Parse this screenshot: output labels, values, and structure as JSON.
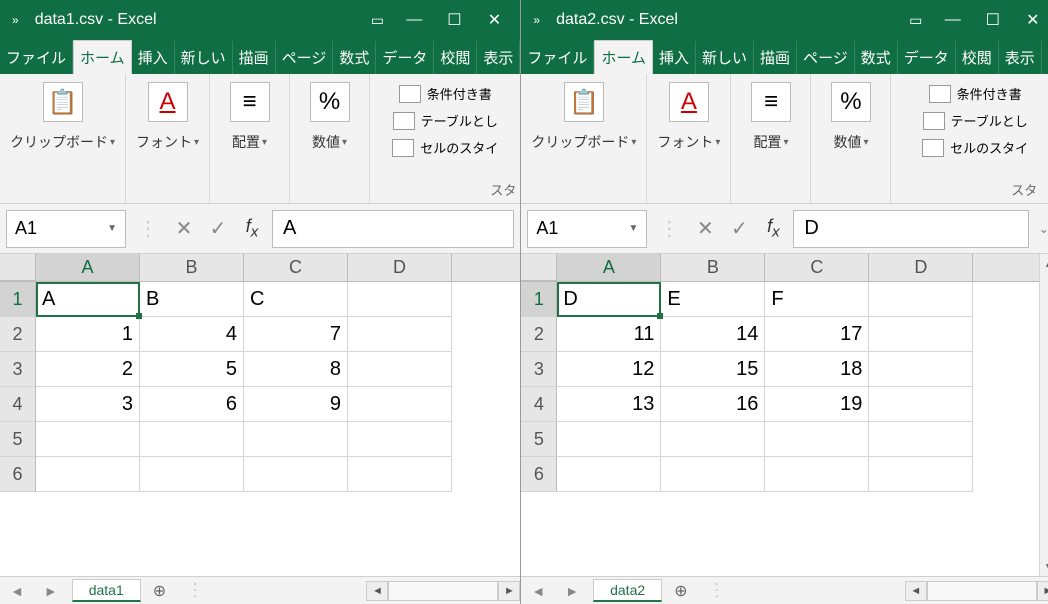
{
  "tabs": {
    "file": "ファイル",
    "home": "ホーム",
    "insert": "挿入",
    "new": "新しい",
    "draw": "描画",
    "page": "ページ",
    "formula": "数式",
    "data": "データ",
    "review": "校閲",
    "view": "表示"
  },
  "ribbon_groups": {
    "clipboard": "クリップボード",
    "font": "フォント",
    "align": "配置",
    "number": "数値",
    "styles_label": "スタ",
    "cond_fmt": "条件付き書",
    "as_table": "テーブルとし",
    "cell_styles": "セルのスタイ"
  },
  "icons": {
    "font": "A",
    "percent": "%"
  },
  "columns": [
    "A",
    "B",
    "C",
    "D"
  ],
  "windows": [
    {
      "title": "data1.csv  -  Excel",
      "namebox": "A1",
      "formula_value": "A",
      "sheet_name": "data1",
      "active": {
        "row": 0,
        "col": 0
      },
      "has_vscroll": false,
      "has_fx_expand": false,
      "rows": [
        {
          "hdr": "1",
          "cells": [
            {
              "v": "A"
            },
            {
              "v": "B"
            },
            {
              "v": "C"
            },
            {
              "v": ""
            }
          ]
        },
        {
          "hdr": "2",
          "cells": [
            {
              "v": "1",
              "n": true
            },
            {
              "v": "4",
              "n": true
            },
            {
              "v": "7",
              "n": true
            },
            {
              "v": ""
            }
          ]
        },
        {
          "hdr": "3",
          "cells": [
            {
              "v": "2",
              "n": true
            },
            {
              "v": "5",
              "n": true
            },
            {
              "v": "8",
              "n": true
            },
            {
              "v": ""
            }
          ]
        },
        {
          "hdr": "4",
          "cells": [
            {
              "v": "3",
              "n": true
            },
            {
              "v": "6",
              "n": true
            },
            {
              "v": "9",
              "n": true
            },
            {
              "v": ""
            }
          ]
        },
        {
          "hdr": "5",
          "cells": [
            {
              "v": ""
            },
            {
              "v": ""
            },
            {
              "v": ""
            },
            {
              "v": ""
            }
          ]
        },
        {
          "hdr": "6",
          "cells": [
            {
              "v": ""
            },
            {
              "v": ""
            },
            {
              "v": ""
            },
            {
              "v": ""
            }
          ]
        }
      ]
    },
    {
      "title": "data2.csv  -  Excel",
      "namebox": "A1",
      "formula_value": "D",
      "sheet_name": "data2",
      "active": {
        "row": 0,
        "col": 0
      },
      "has_vscroll": true,
      "has_fx_expand": true,
      "rows": [
        {
          "hdr": "1",
          "cells": [
            {
              "v": "D"
            },
            {
              "v": "E"
            },
            {
              "v": "F"
            },
            {
              "v": ""
            }
          ]
        },
        {
          "hdr": "2",
          "cells": [
            {
              "v": "11",
              "n": true
            },
            {
              "v": "14",
              "n": true
            },
            {
              "v": "17",
              "n": true
            },
            {
              "v": ""
            }
          ]
        },
        {
          "hdr": "3",
          "cells": [
            {
              "v": "12",
              "n": true
            },
            {
              "v": "15",
              "n": true
            },
            {
              "v": "18",
              "n": true
            },
            {
              "v": ""
            }
          ]
        },
        {
          "hdr": "4",
          "cells": [
            {
              "v": "13",
              "n": true
            },
            {
              "v": "16",
              "n": true
            },
            {
              "v": "19",
              "n": true
            },
            {
              "v": ""
            }
          ]
        },
        {
          "hdr": "5",
          "cells": [
            {
              "v": ""
            },
            {
              "v": ""
            },
            {
              "v": ""
            },
            {
              "v": ""
            }
          ]
        },
        {
          "hdr": "6",
          "cells": [
            {
              "v": ""
            },
            {
              "v": ""
            },
            {
              "v": ""
            },
            {
              "v": ""
            }
          ]
        }
      ]
    }
  ]
}
